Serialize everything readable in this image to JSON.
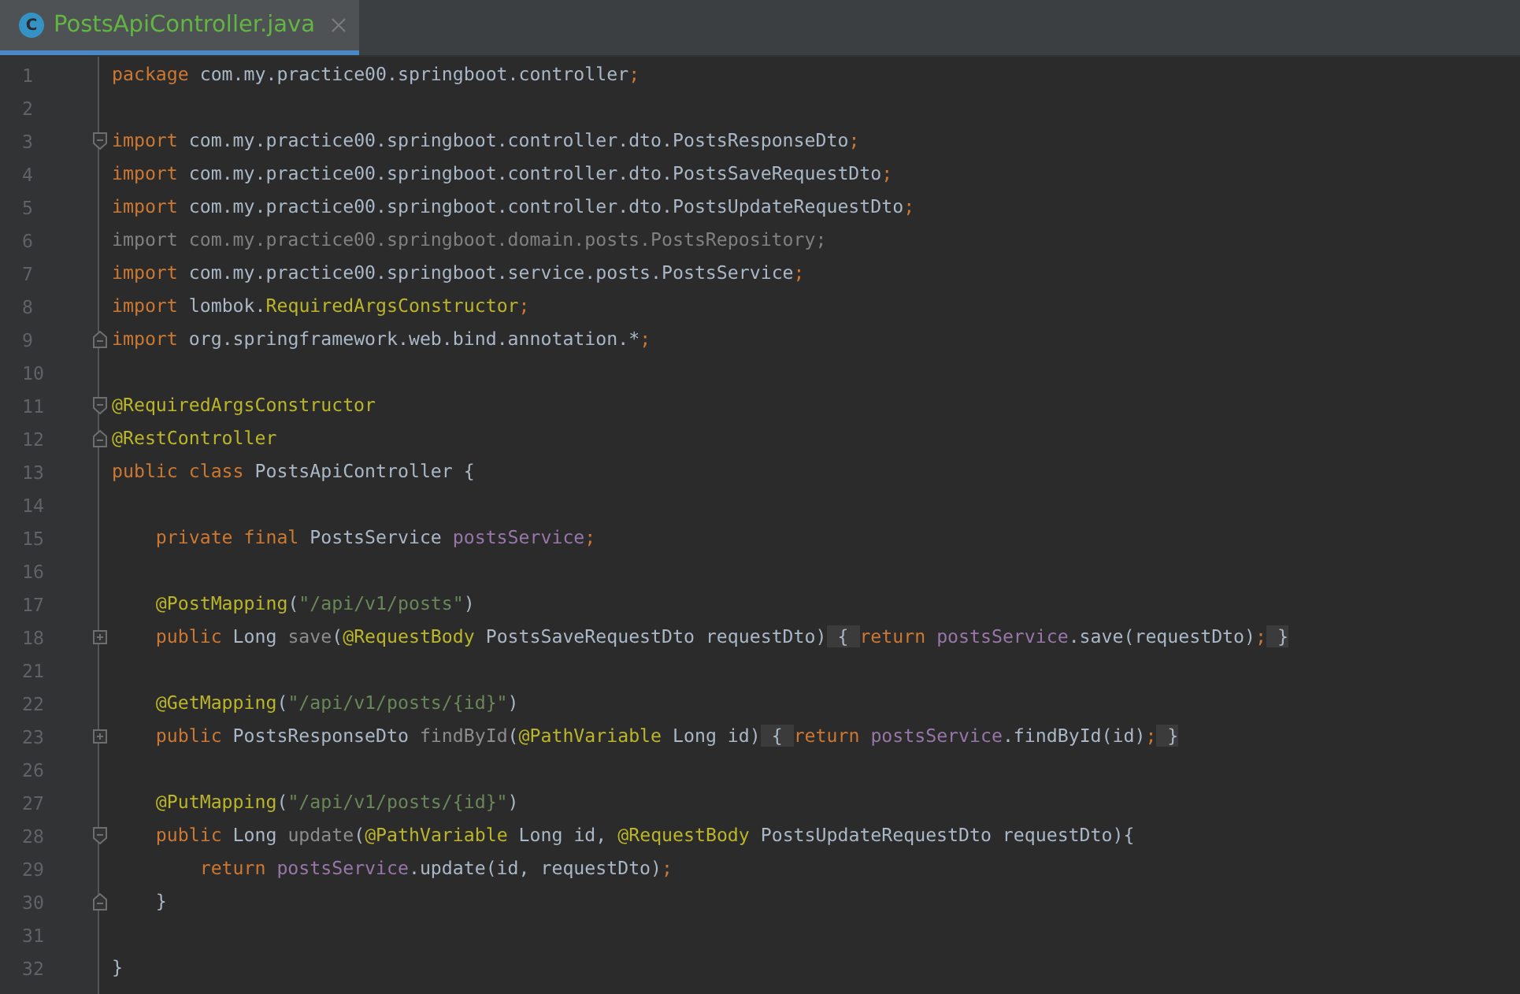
{
  "tabs": [
    {
      "icon_letter": "C",
      "label": "PostsApiController.java",
      "selected": true
    }
  ],
  "lines": [
    {
      "number": "1",
      "tokens": [
        {
          "kind": "kw",
          "text": "package "
        },
        {
          "kind": "plain",
          "text": "com.my.practice00.springboot.controller"
        },
        {
          "kind": "kw",
          "text": ";"
        }
      ]
    },
    {
      "number": "2"
    },
    {
      "number": "3",
      "fold_marker": {
        "kind": "start"
      },
      "tokens": [
        {
          "kind": "kw",
          "text": "import "
        },
        {
          "kind": "plain",
          "text": "com.my.practice00.springboot.controller.dto.PostsResponseDto"
        },
        {
          "kind": "kw",
          "text": ";"
        }
      ]
    },
    {
      "number": "4",
      "tokens": [
        {
          "kind": "kw",
          "text": "import "
        },
        {
          "kind": "plain",
          "text": "com.my.practice00.springboot.controller.dto.PostsSaveRequestDto"
        },
        {
          "kind": "kw",
          "text": ";"
        }
      ]
    },
    {
      "number": "5",
      "tokens": [
        {
          "kind": "kw",
          "text": "import "
        },
        {
          "kind": "plain",
          "text": "com.my.practice00.springboot.controller.dto.PostsUpdateRequestDto"
        },
        {
          "kind": "kw",
          "text": ";"
        }
      ]
    },
    {
      "number": "6",
      "tokens": [
        {
          "kind": "unused",
          "text": "import com.my.practice00.springboot.domain.posts.PostsRepository;"
        }
      ]
    },
    {
      "number": "7",
      "tokens": [
        {
          "kind": "kw",
          "text": "import "
        },
        {
          "kind": "plain",
          "text": "com.my.practice00.springboot.service.posts.PostsService"
        },
        {
          "kind": "kw",
          "text": ";"
        }
      ]
    },
    {
      "number": "8",
      "tokens": [
        {
          "kind": "kw",
          "text": "import "
        },
        {
          "kind": "plain",
          "text": "lombok."
        },
        {
          "kind": "ann",
          "text": "RequiredArgsConstructor"
        },
        {
          "kind": "kw",
          "text": ";"
        }
      ]
    },
    {
      "number": "9",
      "fold_marker": {
        "kind": "end"
      },
      "tokens": [
        {
          "kind": "kw",
          "text": "import "
        },
        {
          "kind": "plain",
          "text": "org.springframework.web.bind.annotation.*"
        },
        {
          "kind": "kw",
          "text": ";"
        }
      ]
    },
    {
      "number": "10"
    },
    {
      "number": "11",
      "fold_marker": {
        "kind": "start"
      },
      "tokens": [
        {
          "kind": "ann",
          "text": "@RequiredArgsConstructor"
        }
      ]
    },
    {
      "number": "12",
      "fold_marker": {
        "kind": "end"
      },
      "tokens": [
        {
          "kind": "ann",
          "text": "@RestController"
        }
      ]
    },
    {
      "number": "13",
      "tokens": [
        {
          "kind": "kw",
          "text": "public class "
        },
        {
          "kind": "plain",
          "text": "PostsApiController {"
        }
      ]
    },
    {
      "number": "14"
    },
    {
      "number": "15",
      "tokens": [
        {
          "kind": "kw",
          "text": "    private final "
        },
        {
          "kind": "plain",
          "text": "PostsService "
        },
        {
          "kind": "field",
          "text": "postsService"
        },
        {
          "kind": "kw",
          "text": ";"
        }
      ]
    },
    {
      "number": "16"
    },
    {
      "number": "17",
      "tokens": [
        {
          "kind": "ann",
          "text": "    @PostMapping"
        },
        {
          "kind": "plain",
          "text": "("
        },
        {
          "kind": "str",
          "text": "\"/api/v1/posts\""
        },
        {
          "kind": "plain",
          "text": ")"
        }
      ]
    },
    {
      "number": "18",
      "fold_marker": {
        "kind": "collapsed"
      },
      "tokens": [
        {
          "kind": "kw",
          "text": "    public "
        },
        {
          "kind": "plain",
          "text": "Long "
        },
        {
          "kind": "method",
          "text": "save"
        },
        {
          "kind": "plain",
          "text": "("
        },
        {
          "kind": "ann",
          "text": "@RequestBody"
        },
        {
          "kind": "plain",
          "text": " PostsSaveRequestDto requestDto)"
        },
        {
          "kind": "folded",
          "text": " { "
        },
        {
          "kind": "kw",
          "text": "return "
        },
        {
          "kind": "field",
          "text": "postsService"
        },
        {
          "kind": "plain",
          "text": ".save(requestDto)"
        },
        {
          "kind": "kw",
          "text": ";"
        },
        {
          "kind": "folded",
          "text": " }"
        }
      ]
    },
    {
      "number": "21"
    },
    {
      "number": "22",
      "tokens": [
        {
          "kind": "ann",
          "text": "    @GetMapping"
        },
        {
          "kind": "plain",
          "text": "("
        },
        {
          "kind": "str",
          "text": "\"/api/v1/posts/{id}\""
        },
        {
          "kind": "plain",
          "text": ")"
        }
      ]
    },
    {
      "number": "23",
      "fold_marker": {
        "kind": "collapsed"
      },
      "tokens": [
        {
          "kind": "kw",
          "text": "    public "
        },
        {
          "kind": "plain",
          "text": "PostsResponseDto "
        },
        {
          "kind": "method",
          "text": "findById"
        },
        {
          "kind": "plain",
          "text": "("
        },
        {
          "kind": "ann",
          "text": "@PathVariable"
        },
        {
          "kind": "plain",
          "text": " Long id)"
        },
        {
          "kind": "folded",
          "text": " { "
        },
        {
          "kind": "kw",
          "text": "return "
        },
        {
          "kind": "field",
          "text": "postsService"
        },
        {
          "kind": "plain",
          "text": ".findById(id)"
        },
        {
          "kind": "kw",
          "text": ";"
        },
        {
          "kind": "folded",
          "text": " }"
        }
      ]
    },
    {
      "number": "26"
    },
    {
      "number": "27",
      "tokens": [
        {
          "kind": "ann",
          "text": "    @PutMapping"
        },
        {
          "kind": "plain",
          "text": "("
        },
        {
          "kind": "str",
          "text": "\"/api/v1/posts/{id}\""
        },
        {
          "kind": "plain",
          "text": ")"
        }
      ]
    },
    {
      "number": "28",
      "fold_marker": {
        "kind": "start"
      },
      "tokens": [
        {
          "kind": "kw",
          "text": "    public "
        },
        {
          "kind": "plain",
          "text": "Long "
        },
        {
          "kind": "method",
          "text": "update"
        },
        {
          "kind": "plain",
          "text": "("
        },
        {
          "kind": "ann",
          "text": "@PathVariable"
        },
        {
          "kind": "plain",
          "text": " Long id, "
        },
        {
          "kind": "ann",
          "text": "@RequestBody"
        },
        {
          "kind": "plain",
          "text": " PostsUpdateRequestDto requestDto){"
        }
      ]
    },
    {
      "number": "29",
      "tokens": [
        {
          "kind": "kw",
          "text": "        return "
        },
        {
          "kind": "field",
          "text": "postsService"
        },
        {
          "kind": "plain",
          "text": ".update(id, requestDto)"
        },
        {
          "kind": "kw",
          "text": ";"
        }
      ]
    },
    {
      "number": "30",
      "fold_marker": {
        "kind": "end"
      },
      "tokens": [
        {
          "kind": "plain",
          "text": "    }"
        }
      ]
    },
    {
      "number": "31"
    },
    {
      "number": "32",
      "tokens": [
        {
          "kind": "plain",
          "text": "}"
        }
      ]
    }
  ]
}
